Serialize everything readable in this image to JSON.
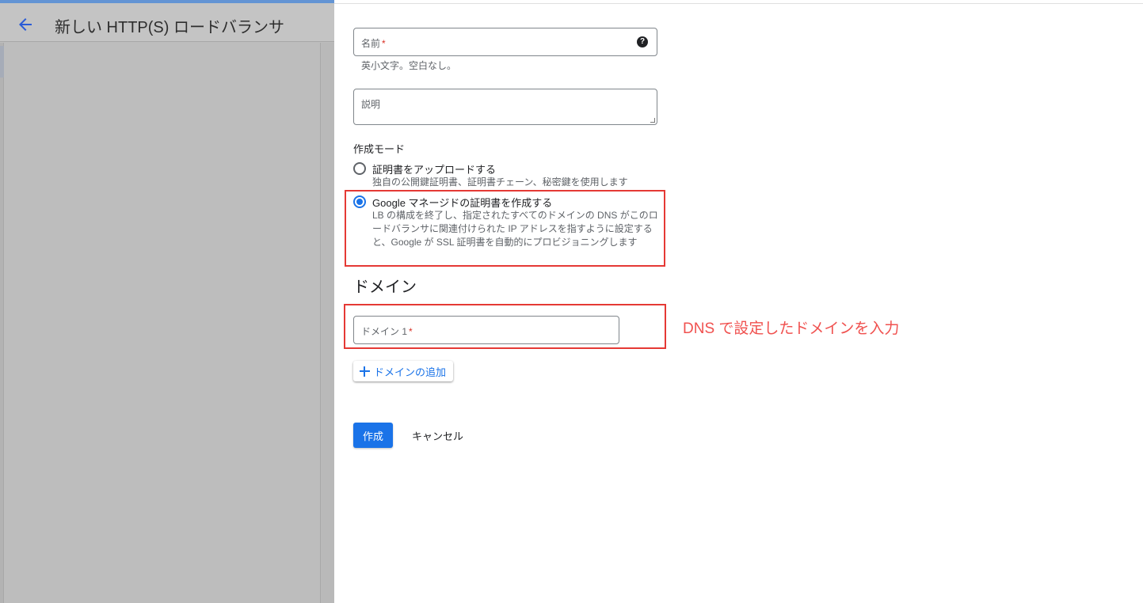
{
  "header": {
    "title": "新しい HTTP(S) ロードバランサ"
  },
  "form": {
    "name": {
      "label": "名前",
      "required_mark": "*",
      "help_icon": "?",
      "hint": "英小文字。空白なし。"
    },
    "description": {
      "label": "説明"
    },
    "creation_mode": {
      "label": "作成モード",
      "options": [
        {
          "label": "証明書をアップロードする",
          "description": "独自の公開鍵証明書、証明書チェーン、秘密鍵を使用します",
          "selected": false
        },
        {
          "label": "Google マネージドの証明書を作成する",
          "description": "LB の構成を終了し、指定されたすべてのドメインの DNS がこのロードバランサに関連付けられた IP アドレスを指すように設定すると、Google が SSL 証明書を自動的にプロビジョニングします",
          "selected": true
        }
      ]
    },
    "domains": {
      "heading": "ドメイン",
      "field_label": "ドメイン 1",
      "required_mark": "*",
      "add_label": "ドメインの追加"
    },
    "actions": {
      "create": "作成",
      "cancel": "キャンセル"
    }
  },
  "annotations": {
    "domain_note": "DNS で設定したドメインを入力",
    "highlight_color": "#e53935",
    "note_color": "#f0514f"
  },
  "colors": {
    "accent": "#1a73e8",
    "required": "#d93025"
  }
}
